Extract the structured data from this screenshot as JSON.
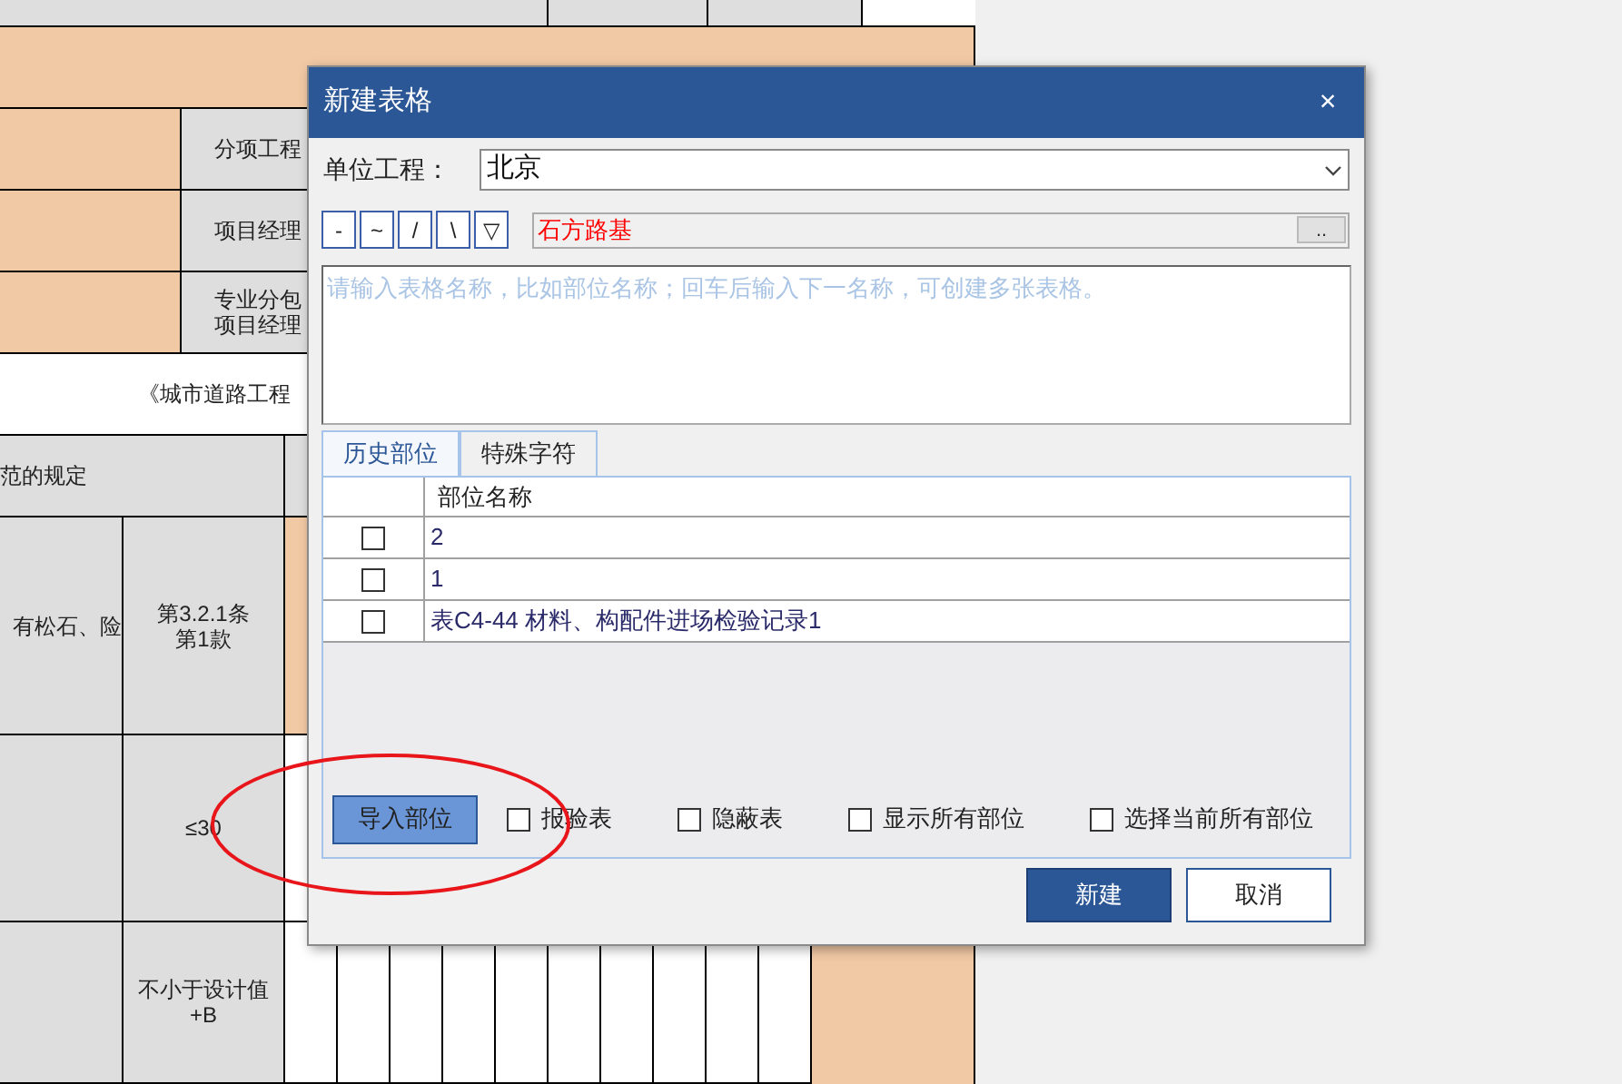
{
  "sheet": {
    "labels": [
      [
        "分项工程"
      ],
      [
        "项目经理"
      ],
      [
        "专业分包",
        "项目经理"
      ]
    ],
    "title": "《城市道路工程",
    "section": "范的规定",
    "item_text": "有松石、险",
    "clause": [
      "第3.2.1条",
      "第1款"
    ],
    "limit": "≤30",
    "requirement": [
      "不小于设计值",
      "+B"
    ]
  },
  "window": {
    "title": "新建表格",
    "close": "×"
  },
  "unit_project": {
    "label": "单位工程：",
    "value": "北京"
  },
  "symbol_buttons": [
    "-",
    "~",
    "/",
    "\\",
    "▽"
  ],
  "part_field": {
    "value": "石方路基",
    "browse": ".."
  },
  "name_input": {
    "placeholder": "请输入表格名称，比如部位名称；回车后输入下一名称，可创建多张表格。"
  },
  "tabs": [
    {
      "label": "历史部位",
      "selected": true
    },
    {
      "label": "特殊字符",
      "selected": false
    }
  ],
  "table": {
    "columns": [
      "部位名称"
    ],
    "rows": [
      {
        "name": "2",
        "checked": false
      },
      {
        "name": "1",
        "checked": false
      },
      {
        "name": "表C4-44 材料、构配件进场检验记录1",
        "checked": false
      }
    ]
  },
  "import_button": "导入部位",
  "options": [
    {
      "label": "报验表",
      "checked": false
    },
    {
      "label": "隐蔽表",
      "checked": false
    },
    {
      "label": "显示所有部位",
      "checked": false
    },
    {
      "label": "选择当前所有部位",
      "checked": false
    }
  ],
  "buttons": [
    {
      "label": "新建",
      "kind": "primary"
    },
    {
      "label": "取消",
      "kind": "secondary"
    }
  ]
}
